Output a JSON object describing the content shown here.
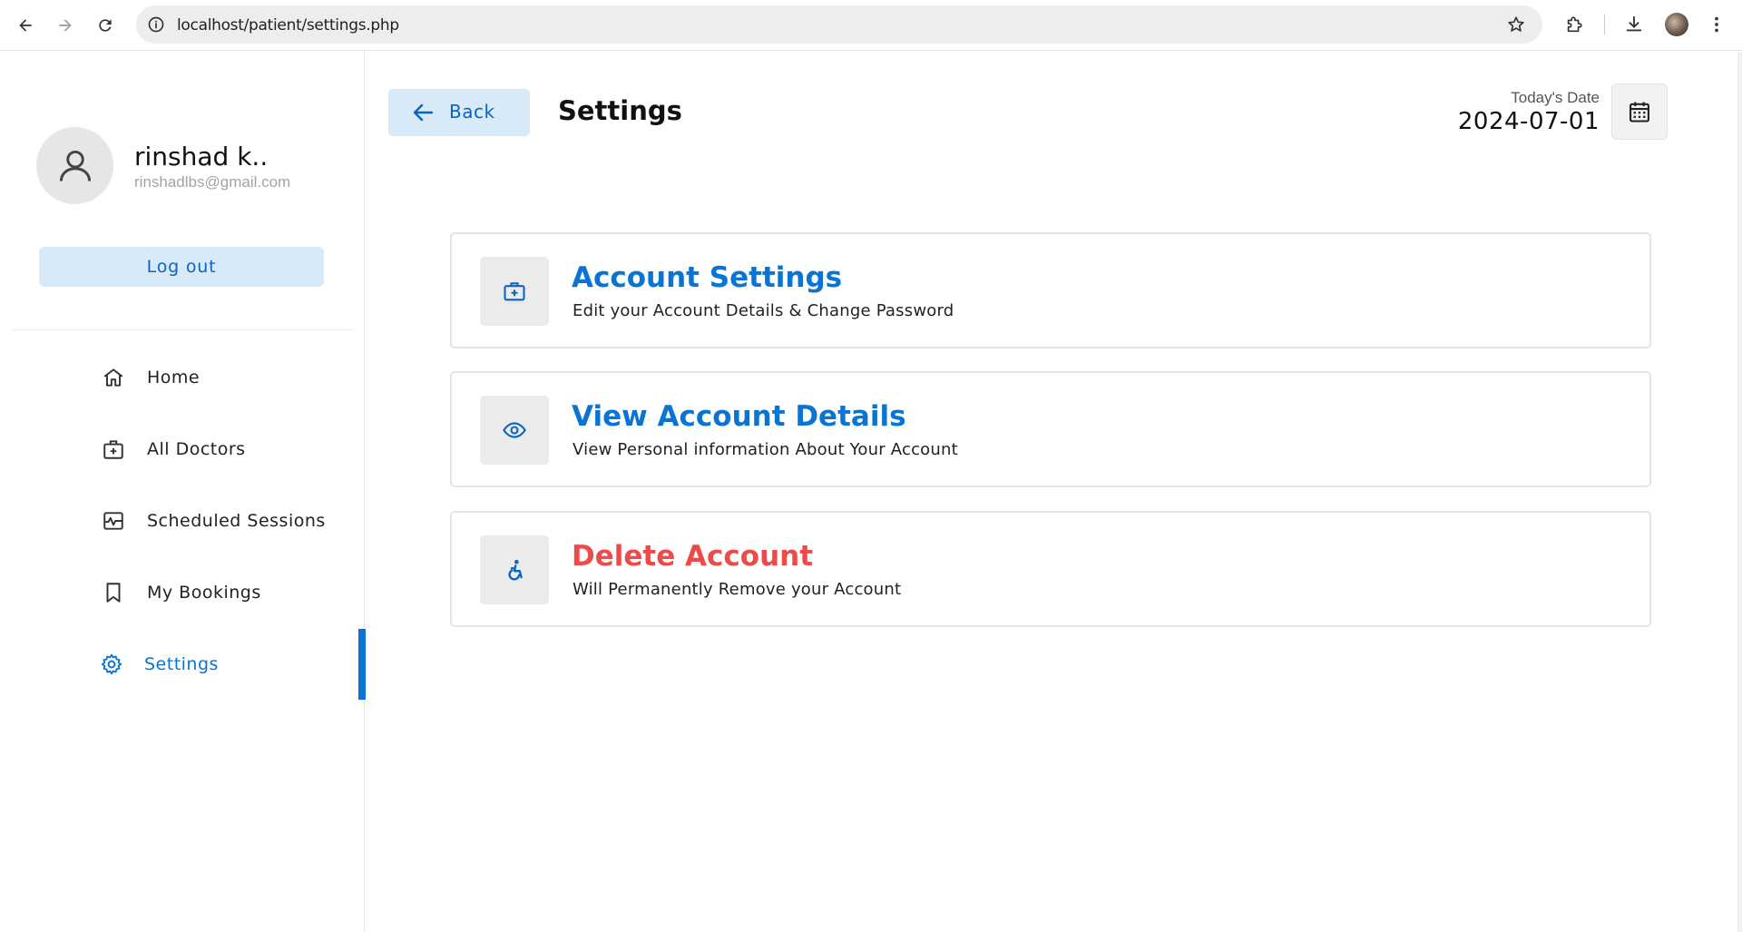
{
  "browser": {
    "url": "localhost/patient/settings.php"
  },
  "user": {
    "name": "rinshad k..",
    "email": "rinshadlbs@gmail.com",
    "logout_label": "Log out"
  },
  "sidebar": {
    "items": [
      {
        "label": "Home",
        "icon": "home-icon"
      },
      {
        "label": "All Doctors",
        "icon": "doctor-icon"
      },
      {
        "label": "Scheduled Sessions",
        "icon": "sessions-icon"
      },
      {
        "label": "My Bookings",
        "icon": "bookmark-icon"
      },
      {
        "label": "Settings",
        "icon": "gear-icon",
        "active": true
      }
    ]
  },
  "header": {
    "back_label": "Back",
    "title": "Settings",
    "date_label": "Today's Date",
    "date_value": "2024-07-01"
  },
  "cards": [
    {
      "title": "Account Settings",
      "description": "Edit your Account Details & Change Password",
      "icon": "medical-kit-icon"
    },
    {
      "title": "View Account Details",
      "description": "View Personal information About Your Account",
      "icon": "eye-icon"
    },
    {
      "title": "Delete Account",
      "description": "Will Permanently Remove your Account",
      "icon": "accessibility-icon",
      "danger": true
    }
  ],
  "colors": {
    "accent": "#0a74d4",
    "accent_light": "#d8e9f8",
    "danger": "#ef4a4a"
  }
}
